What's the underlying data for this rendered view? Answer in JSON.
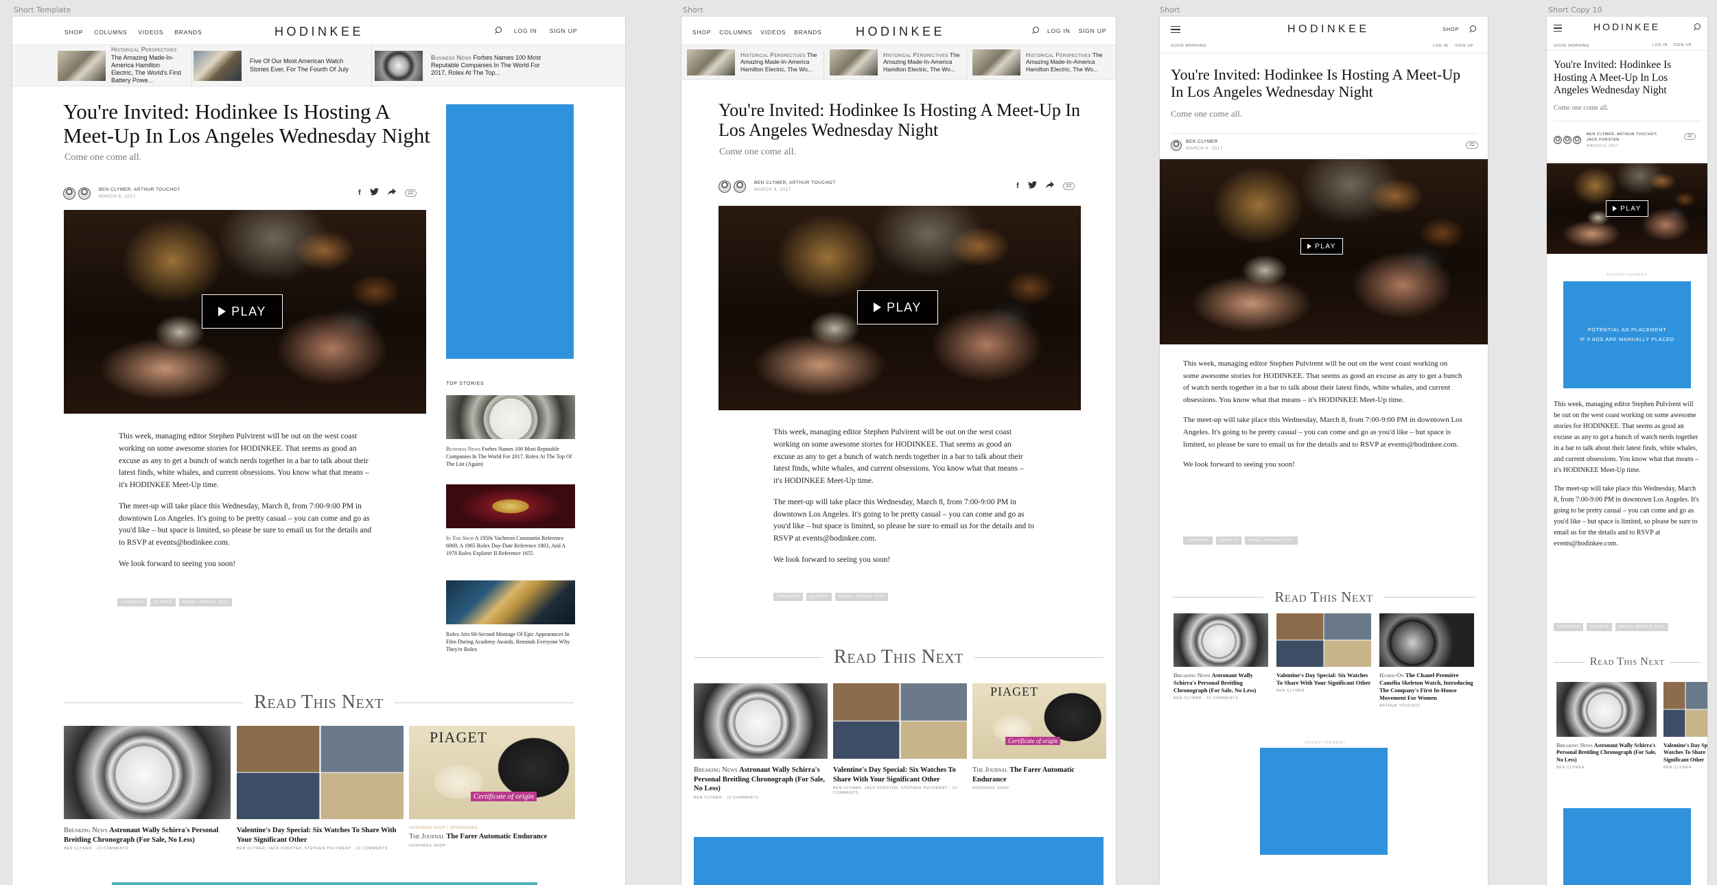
{
  "frames": {
    "template_label": "Short Template",
    "short_label": "Short",
    "mobile_label": "Short",
    "small_label": "Short Copy 10"
  },
  "brand": {
    "logo": "HODINKEE",
    "accent": "#2f92dc"
  },
  "nav": {
    "shop": "SHOP",
    "columns": "COLUMNS",
    "videos": "VIDEOS",
    "brands": "BRANDS",
    "login": "LOG IN",
    "signup": "SIGN UP",
    "search_icon": "search-icon",
    "menu_icon": "hamburger-icon",
    "greeting": "GOOD MORNING"
  },
  "ticker": [
    {
      "kicker": "Historical Perspectives",
      "title": "The Amazing Made-In-America Hamilton Electric, The World's First Battery Powe..."
    },
    {
      "kicker": "",
      "title": "Five Of Our Most American Watch Stories Ever, For The Fourth Of July"
    },
    {
      "kicker": "Business News",
      "title": "Forbes Names 100 Most Reputable Companies In The World For 2017, Rolex At The Top..."
    }
  ],
  "ticker_short": [
    {
      "kicker": "Historical Perspectives",
      "title": "The Amazing Made-In-America Hamilton Electric, The Wo..."
    },
    {
      "kicker": "Historical Perspectives",
      "title": "The Amazing Made-In-America Hamilton Electric, The Wo..."
    },
    {
      "kicker": "Historical Perspectives",
      "title": "The Amazing Made-In-America Hamilton Electric, The Wo..."
    }
  ],
  "article": {
    "title": "You're Invited: Hodinkee Is Hosting A Meet-Up In Los Angeles Wednesday Night",
    "dek": "Come one come all.",
    "authors": "BEN CLYMER, ARTHUR TOUCHOT",
    "date": "MARCH 6, 2017",
    "comments": "22",
    "play_label": "PLAY",
    "p1": "This week, managing editor Stephen Pulvirent will be out on the west coast working on some awesome stories for HODINKEE. That seems as good an excuse as any to get a bunch of watch nerds together in a bar to talk about their latest finds, white whales, and current obsessions. You know what that means – it's HODINKEE Meet-Up time.",
    "p2": "The meet-up will take place this Wednesday, March 8, from 7:00-9:00 PM in downtown Los Angeles. It's going to be pretty casual – you can come and go as you'd like – but space is limited, so please be sure to email us for the details and to RSVP at events@hodinkee.com.",
    "p3": "We look forward to seeing you soon!",
    "tags": [
      "LONDONS",
      "QUARTZ",
      "BASEL-WORLD-2017"
    ]
  },
  "mobile": {
    "author": "BEN CLYMER",
    "shop": "SHOP"
  },
  "small": {
    "authors": "BEN CLYMER, ARTHUR TOUCHOT, JACK FORSTER",
    "ad_text_1": "POTENTIAL AD PLACEMENT",
    "ad_text_2": "IF 0 ADS ARE MANUALLY PLACED",
    "ad_label": "ADVERTISEMENT"
  },
  "sidebar": {
    "heading": "TOP STORIES",
    "stories": [
      {
        "kicker": "Business News",
        "title": "Forbes Names 100 Most Reputable Companies In The World For 2017, Rolex At The Top Of The List (Again)"
      },
      {
        "kicker": "In The Shop",
        "title": "A 1950s Vacheron Constantin Reference 6069, A 1965 Rolex Day-Date Reference 1803, And A 1978 Rolex Explorer II Reference 1655"
      },
      {
        "kicker": "",
        "title": "Rolex Airs 60-Second Montage Of Epic Appearances In Film During Academy Awards, Reminds Everyone Why They're Rolex"
      }
    ]
  },
  "read_next": {
    "heading": "Read This Next",
    "cards": [
      {
        "kicker": "Breaking News",
        "title": "Astronaut Wally Schirra's Personal Breitling Chronograph (For Sale, No Less)",
        "meta": "BEN CLYMER · 22 COMMENTS",
        "sponsored": ""
      },
      {
        "kicker": "",
        "title": "Valentine's Day Special: Six Watches To Share With Your Significant Other",
        "meta": "BEN CLYMER, JACK FORSTER, STEPHEN PULVIRENT · 22 COMMENTS",
        "sponsored": ""
      },
      {
        "kicker": "The Journal",
        "title": "The Farer Automatic Endurance",
        "meta": "HODINKEE SHOP",
        "sponsored": "HODINKEE SHOP | SPONSORED"
      }
    ],
    "mobile_cards": [
      {
        "kicker": "Breaking News",
        "title": "Astronaut Wally Schirra's Personal Breitling Chronograph (For Sale, No Less)",
        "meta": "BEN CLYMER · 22 COMMENTS"
      },
      {
        "kicker": "",
        "title": "Valentine's Day Special: Six Watches To Share With Your Significant Other",
        "meta": "BEN CLYMER"
      },
      {
        "kicker": "Hands-On",
        "title": "The Chanel Première Camélia Skeleton Watch, Introducing The Company's First In-House Movement For Women",
        "meta": "ARTHUR TOUCHOT"
      }
    ],
    "small_cards": [
      {
        "kicker": "Breaking News",
        "title": "Astronaut Wally Schirra's Personal Breitling Chronograph (For Sale, No Less)",
        "meta": "BEN CLYMER"
      },
      {
        "kicker": "",
        "title": "Valentine's Day Special: Six Watches To Share With Your Significant Other",
        "meta": "BEN CLYMER"
      }
    ],
    "piaget": "PIAGET",
    "cert": "Certificate of origin"
  }
}
